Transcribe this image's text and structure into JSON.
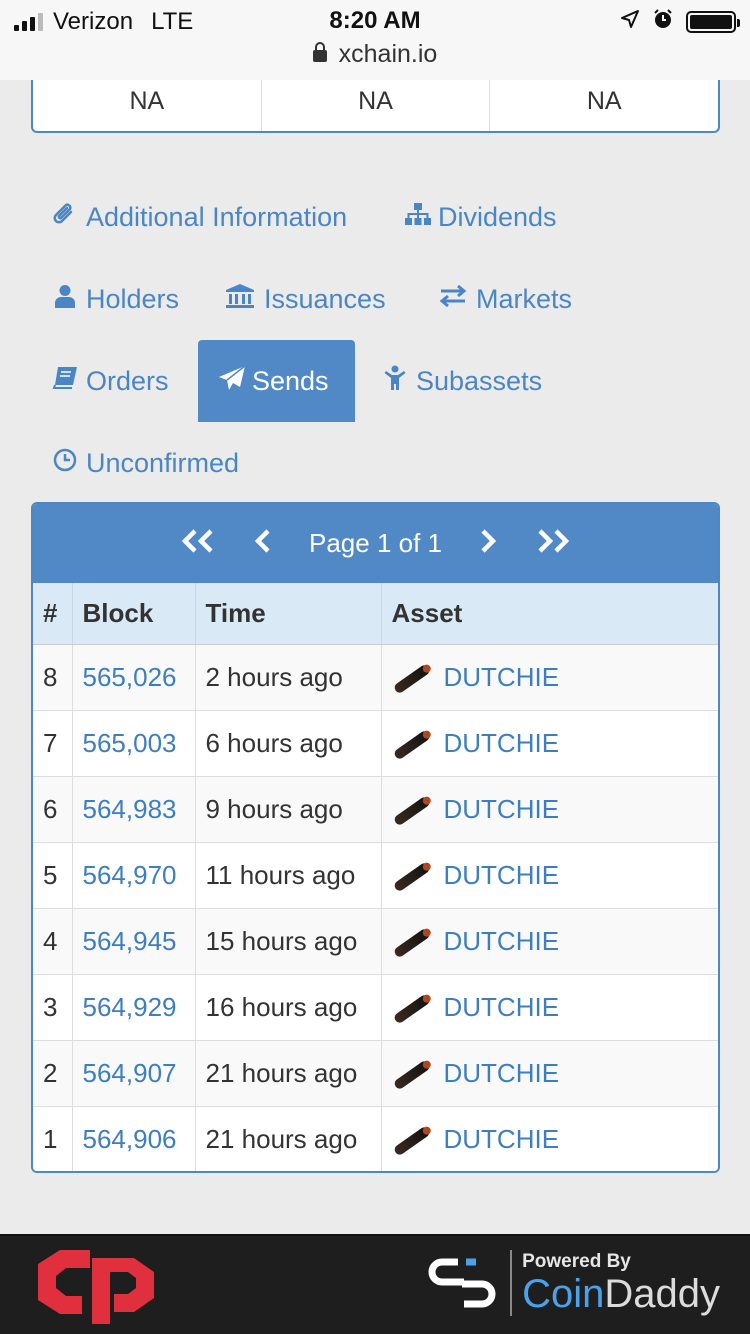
{
  "status_bar": {
    "carrier": "Verizon",
    "network": "LTE",
    "time": "8:20 AM",
    "url": "xchain.io"
  },
  "summary_cells": [
    "NA",
    "NA",
    "NA"
  ],
  "tabs": [
    {
      "label": "Additional Information",
      "icon": "paperclip-icon",
      "active": false
    },
    {
      "label": "Dividends",
      "icon": "sitemap-icon",
      "active": false
    },
    {
      "label": "Holders",
      "icon": "user-icon",
      "active": false
    },
    {
      "label": "Issuances",
      "icon": "bank-icon",
      "active": false
    },
    {
      "label": "Markets",
      "icon": "exchange-icon",
      "active": false
    },
    {
      "label": "Orders",
      "icon": "book-icon",
      "active": false
    },
    {
      "label": "Sends",
      "icon": "paper-plane-icon",
      "active": true
    },
    {
      "label": "Subassets",
      "icon": "child-icon",
      "active": false
    },
    {
      "label": "Unconfirmed",
      "icon": "clock-icon",
      "active": false
    }
  ],
  "pager": {
    "first": "«",
    "prev": "‹",
    "text": "Page 1 of 1",
    "next": "›",
    "last": "»"
  },
  "table": {
    "headers": [
      "#",
      "Block",
      "Time",
      "Asset"
    ],
    "rows": [
      {
        "num": "8",
        "block": "565,026",
        "time": "2 hours ago",
        "asset": "DUTCHIE"
      },
      {
        "num": "7",
        "block": "565,003",
        "time": "6 hours ago",
        "asset": "DUTCHIE"
      },
      {
        "num": "6",
        "block": "564,983",
        "time": "9 hours ago",
        "asset": "DUTCHIE"
      },
      {
        "num": "5",
        "block": "564,970",
        "time": "11 hours ago",
        "asset": "DUTCHIE"
      },
      {
        "num": "4",
        "block": "564,945",
        "time": "15 hours ago",
        "asset": "DUTCHIE"
      },
      {
        "num": "3",
        "block": "564,929",
        "time": "16 hours ago",
        "asset": "DUTCHIE"
      },
      {
        "num": "2",
        "block": "564,907",
        "time": "21 hours ago",
        "asset": "DUTCHIE"
      },
      {
        "num": "1",
        "block": "564,906",
        "time": "21 hours ago",
        "asset": "DUTCHIE"
      }
    ]
  },
  "footer": {
    "powered_by": "Powered By",
    "brand_c": "Coin",
    "brand_rest": "Daddy"
  },
  "colors": {
    "accent": "#5189c7",
    "link": "#3d7ec1",
    "header_bg": "#d9e9f5",
    "footer_bg": "#1e1e1e",
    "logo_red": "#e0303e"
  }
}
